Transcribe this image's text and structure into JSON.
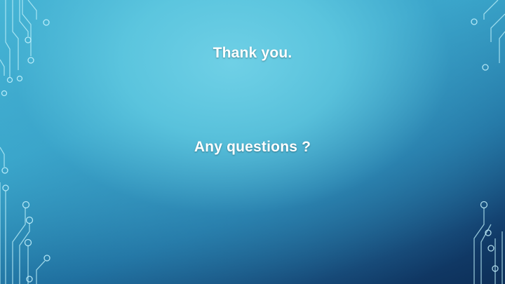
{
  "slide": {
    "line1": "Thank you.",
    "line2": "Any questions ?"
  },
  "decor": {
    "icon": "circuit-traces-decoration",
    "trace_color": "#bef0fa",
    "background_light": "#6fd0e6",
    "background_dark": "#0d2f58"
  }
}
